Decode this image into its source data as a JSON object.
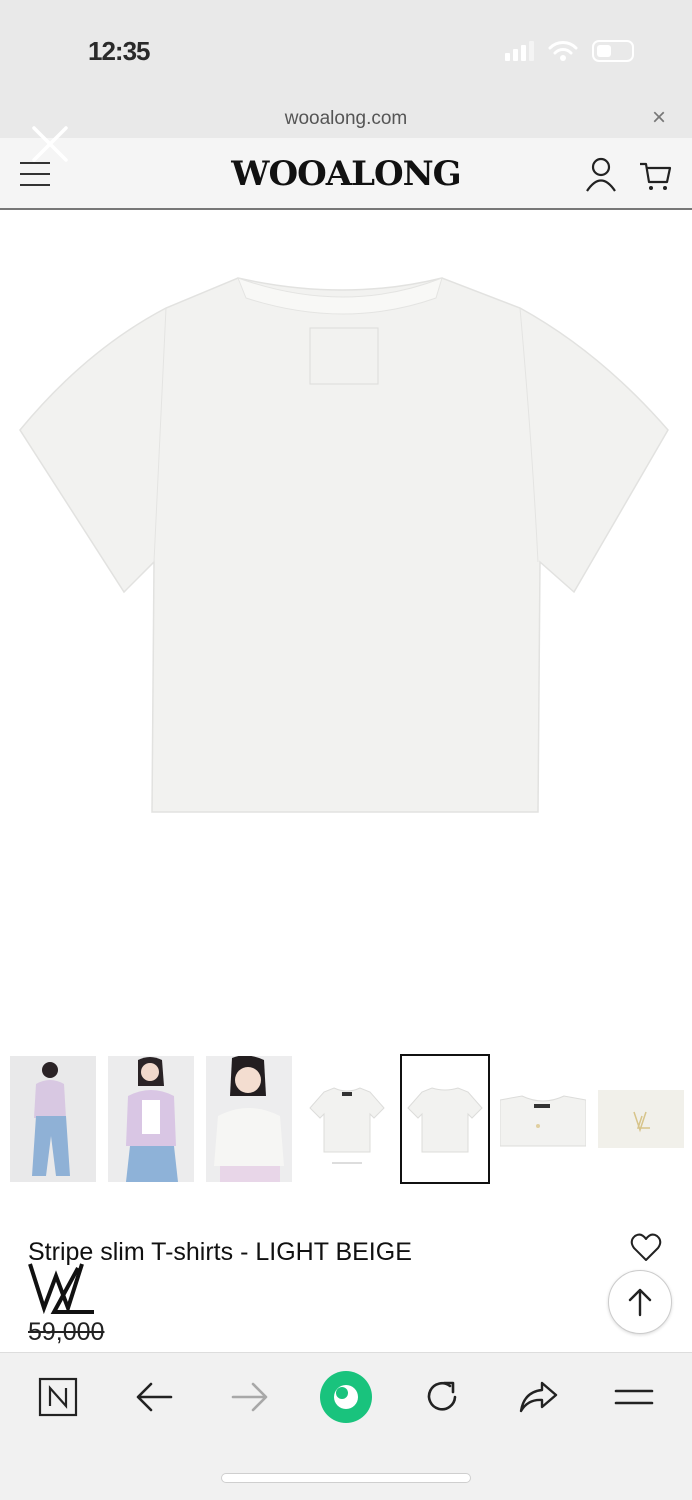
{
  "status_bar": {
    "time": "12:35"
  },
  "browser": {
    "url": "wooalong.com",
    "close_glyph": "×"
  },
  "site": {
    "brand": "WOOALONG"
  },
  "product": {
    "title": "Stripe slim T-shirts - LIGHT BEIGE",
    "price": "59,000"
  },
  "thumbnails": [
    {
      "name": "model-full-body-jeans"
    },
    {
      "name": "model-cardigan-jeans"
    },
    {
      "name": "model-portrait-tee"
    },
    {
      "name": "tee-front"
    },
    {
      "name": "tee-back",
      "selected": true
    },
    {
      "name": "tee-collar-detail"
    },
    {
      "name": "logo-embroidery-detail"
    }
  ],
  "toolbar": {
    "items": [
      "N",
      "back",
      "forward",
      "home",
      "reload",
      "share",
      "menu"
    ]
  },
  "colors": {
    "tshirt": "#f4f4f2",
    "accent_green": "#19c37d",
    "header_bg": "#f5f5f5",
    "chrome_bg": "#e9e9e9"
  }
}
